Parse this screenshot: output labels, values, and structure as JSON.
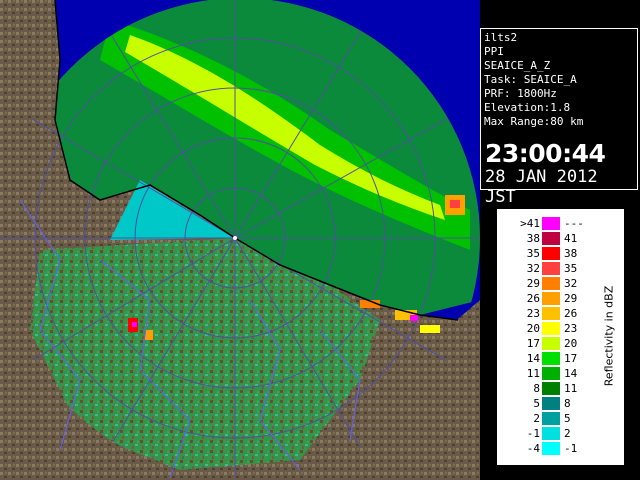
{
  "info_panel": {
    "lines": [
      "ilts2",
      "PPI",
      "SEAICE_A_Z",
      "Task: SEAICE_A",
      "PRF: 1800Hz",
      "Elevation:1.8",
      "Max Range:80 km"
    ],
    "time": "23:00:44",
    "date": "28 JAN 2012 JST"
  },
  "legend": {
    "title": "Reflectivity in dBZ",
    "rows": [
      {
        "low": ">41",
        "high": "---",
        "color": "#ff00ff"
      },
      {
        "low": "38",
        "high": "41",
        "color": "#c00040"
      },
      {
        "low": "35",
        "high": "38",
        "color": "#ff0000"
      },
      {
        "low": "32",
        "high": "35",
        "color": "#ff4040"
      },
      {
        "low": "29",
        "high": "32",
        "color": "#ff8000"
      },
      {
        "low": "26",
        "high": "29",
        "color": "#ffa000"
      },
      {
        "low": "23",
        "high": "26",
        "color": "#ffc000"
      },
      {
        "low": "20",
        "high": "23",
        "color": "#ffff00"
      },
      {
        "low": "17",
        "high": "20",
        "color": "#c8ff00"
      },
      {
        "low": "14",
        "high": "17",
        "color": "#00e000"
      },
      {
        "low": "11",
        "high": "14",
        "color": "#00b000"
      },
      {
        "low": "8",
        "high": "11",
        "color": "#008000"
      },
      {
        "low": "5",
        "high": "8",
        "color": "#008080"
      },
      {
        "low": "2",
        "high": "5",
        "color": "#00a0a0"
      },
      {
        "low": "-1",
        "high": "2",
        "color": "#00e0e0"
      },
      {
        "low": "-4",
        "high": "-1",
        "color": "#00ffff"
      }
    ]
  },
  "colors": {
    "sea": "#0000b0",
    "land": "#6a5a48",
    "range_rings": "#5050a0",
    "boundaries": "#6060ff"
  }
}
